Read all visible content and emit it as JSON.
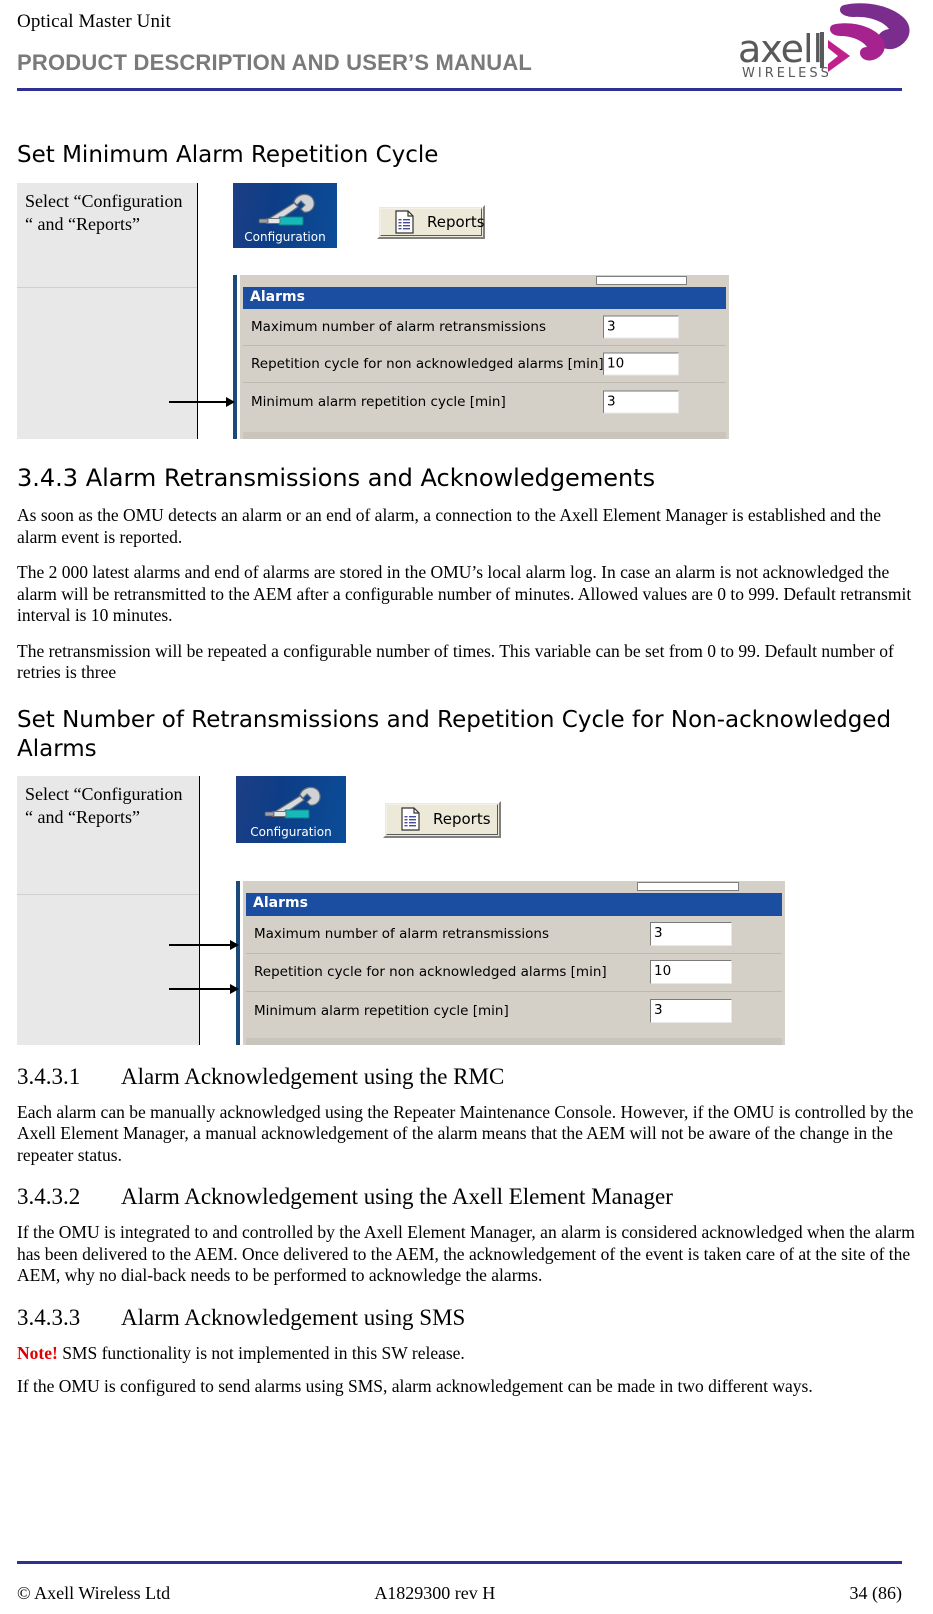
{
  "header": {
    "doc_name": "Optical Master Unit",
    "title": "PRODUCT DESCRIPTION AND USER’S MANUAL",
    "logo_word": "axell",
    "logo_sub": "WIRELESS",
    "rule_color": "#2e3192",
    "title_color": "#7a7a7a",
    "logo_color_dark": "#7b2d8e",
    "logo_color_light": "#c0208c"
  },
  "section_1": {
    "heading": "Set Minimum Alarm Repetition Cycle",
    "figure": {
      "caption": "Select “Configuration “ and “Reports”",
      "config_button_label": "Configuration",
      "reports_button_label": "Reports",
      "dialog": {
        "title": "Alarms",
        "rows": [
          {
            "label": "Maximum number of alarm retransmissions",
            "value": "3"
          },
          {
            "label": "Repetition cycle for non acknowledged alarms [min]",
            "value": "10"
          },
          {
            "label": "Minimum alarm repetition cycle [min]",
            "value": "3"
          }
        ]
      },
      "arrow_targets": [
        "Minimum alarm repetition cycle [min]"
      ]
    }
  },
  "section_343": {
    "heading": "3.4.3 Alarm Retransmissions and Acknowledgements",
    "paragraphs": [
      "As soon as the OMU detects an alarm or an end of alarm, a connection to the Axell Element Manager is established and the alarm event is reported.",
      "The 2 000 latest alarms and end of alarms are stored in the OMU’s local alarm log. In case an alarm is not acknowledged the alarm will be retransmitted to the AEM after a configurable number of minutes. Allowed values are 0 to 999. Default retransmit interval is 10 minutes.",
      "The retransmission will be repeated a configurable number of times. This variable can be set from 0 to 99. Default number of retries is three"
    ]
  },
  "section_2": {
    "heading": "Set Number of Retransmissions and Repetition Cycle for Non-acknowledged Alarms",
    "figure": {
      "caption": "Select “Configuration “ and “Reports”",
      "config_button_label": "Configuration",
      "reports_button_label": "Reports",
      "dialog": {
        "title": "Alarms",
        "rows": [
          {
            "label": "Maximum number of alarm retransmissions",
            "value": "3"
          },
          {
            "label": "Repetition cycle for non acknowledged alarms [min]",
            "value": "10"
          },
          {
            "label": "Minimum alarm repetition cycle [min]",
            "value": "3"
          }
        ]
      },
      "arrow_targets": [
        "Maximum number of alarm retransmissions",
        "Repetition cycle for non acknowledged alarms [min]"
      ]
    }
  },
  "section_3431": {
    "number": "3.4.3.1",
    "title": "Alarm Acknowledgement using the RMC",
    "paragraph": "Each alarm can be manually acknowledged using the Repeater Maintenance Console. However, if the OMU is controlled by the Axell Element Manager, a manual acknowledgement of the alarm means that the AEM will not be aware of the change in the repeater status."
  },
  "section_3432": {
    "number": "3.4.3.2",
    "title": "Alarm Acknowledgement using the Axell Element Manager",
    "paragraph": "If the OMU is integrated to and controlled by the Axell Element Manager, an alarm is considered acknowledged when the alarm has been delivered to the AEM. Once delivered to the AEM, the acknowledgement of the event is taken care of at the site of the AEM, why no dial-back needs to be performed to acknowledge the alarms."
  },
  "section_3433": {
    "number": "3.4.3.3",
    "title": "Alarm Acknowledgement using SMS",
    "note_label": "Note!",
    "note_text": " SMS functionality is not implemented in this SW release.",
    "paragraph": "If the OMU is configured to send alarms using SMS, alarm acknowledgement can be made in two different ways."
  },
  "footer": {
    "left": "© Axell Wireless Ltd",
    "center": "A1829300 rev H",
    "right": "34 (86)",
    "rule_color": "#2e3192"
  }
}
